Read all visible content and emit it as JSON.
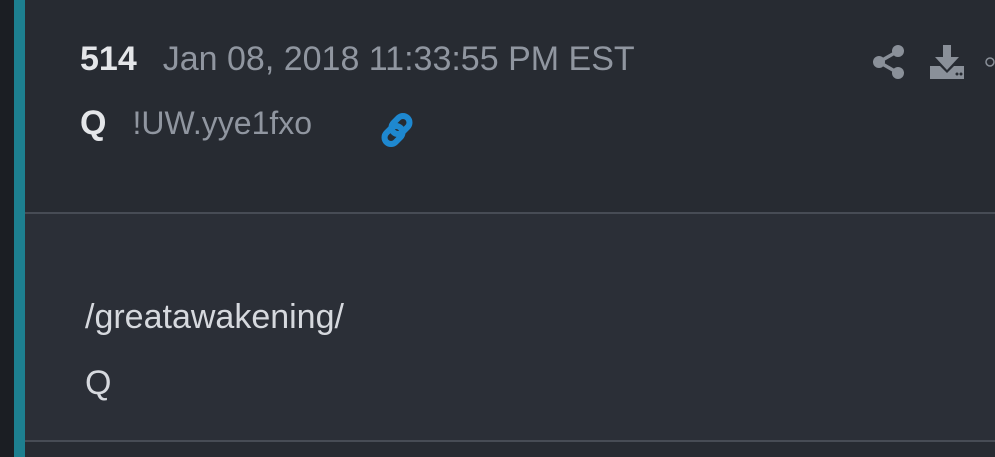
{
  "post": {
    "number": "514",
    "date": "Jan 08, 2018 11:33:55 PM EST",
    "author": "Q",
    "tripcode": "!UW.yye1fxo",
    "body_lines": [
      "/greatawakening/",
      "Q"
    ]
  },
  "icons": {
    "permalink": "link-icon",
    "share": "share-icon",
    "download": "download-icon",
    "more": "circle-icon"
  },
  "colors": {
    "accent_bar": "#1d7f8f",
    "link_blue": "#1e88d0",
    "header_bg": "#272b32",
    "body_bg": "#2b2f37",
    "muted_text": "#9096a0",
    "bright_text": "#e4e6e9"
  }
}
